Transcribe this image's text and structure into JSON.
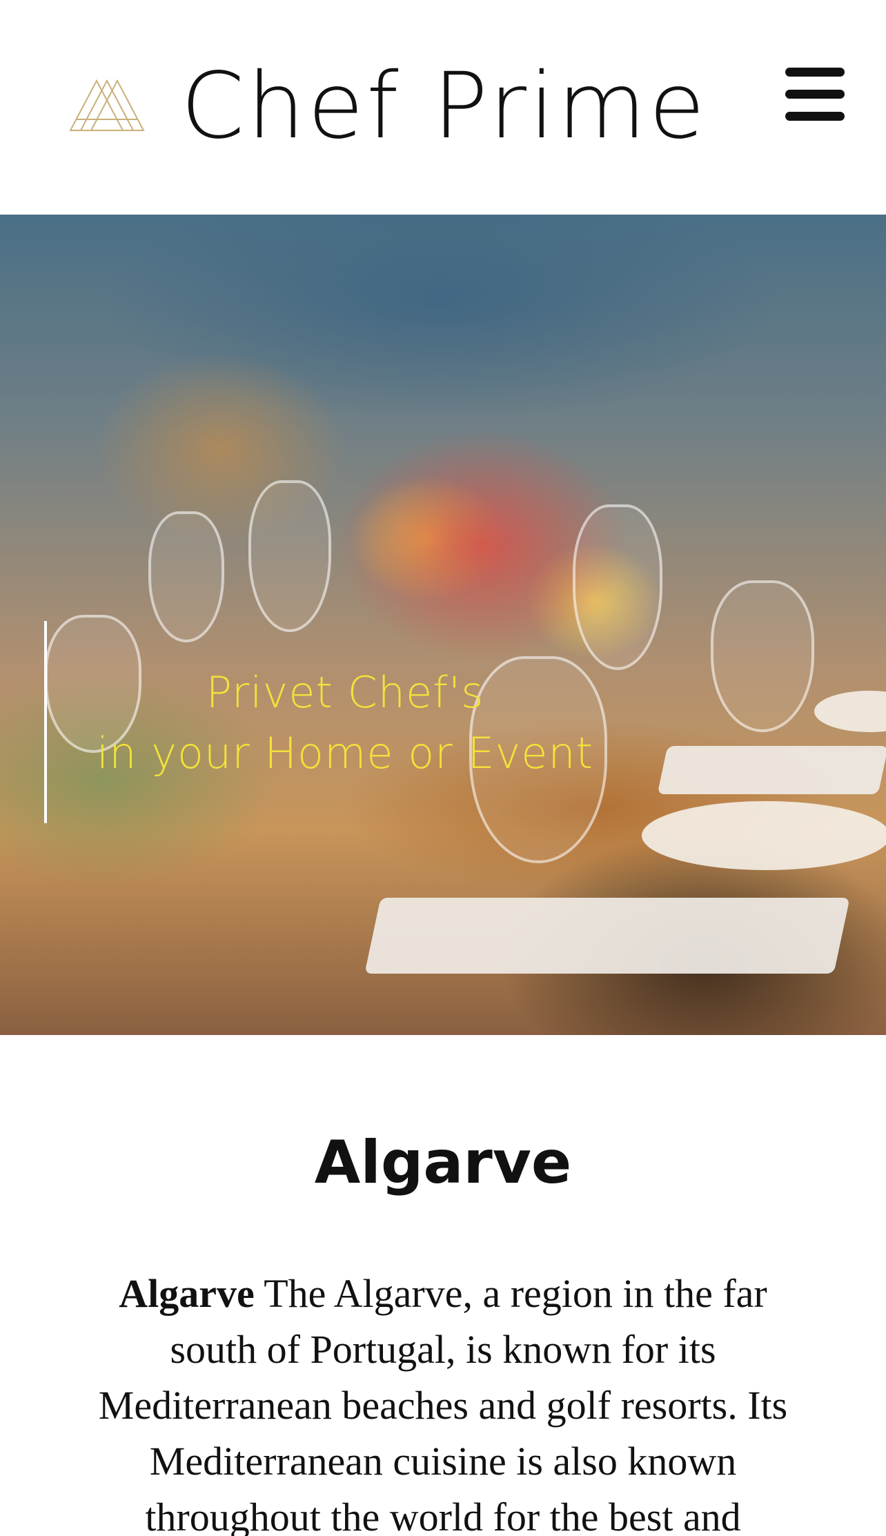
{
  "header": {
    "brand_name": "Chef Prime",
    "logo_icon": "triangle-lines-logo-icon",
    "menu_icon": "hamburger-menu-icon",
    "logo_color": "#c9b07a"
  },
  "hero": {
    "tagline_line1": "Privet Chef's",
    "tagline_line2": "in your Home or Event",
    "tagline_color": "#f3e23a",
    "image_description_icon": "dining-table-photo"
  },
  "content": {
    "title": "Algarve",
    "lead_word": "Algarve",
    "body": " The Algarve, a region in the far south of Portugal, is known for its Mediterranean beaches and golf resorts. Its Mediterranean cuisine is also known throughout the world for the best and"
  }
}
